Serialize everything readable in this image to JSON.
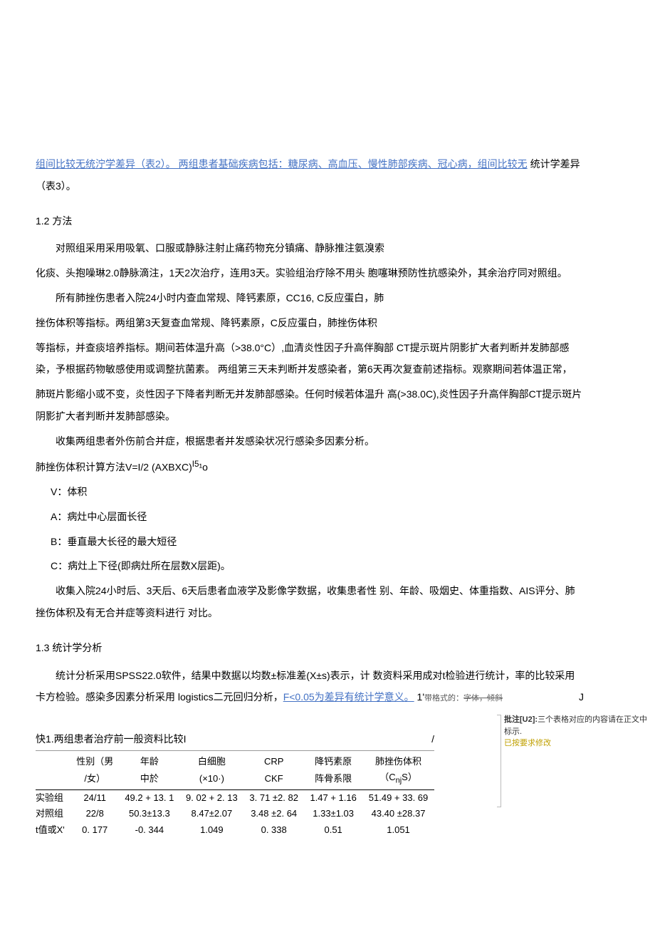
{
  "intro": {
    "link_prefix": "组间比较无统泞学差异（表2）。 两组患者基础疾病包括：糖尿病、高血压、慢性肺部疾病、冠心病，组间比较无",
    "link_suffix": " 统计学差异（表3）。"
  },
  "section_1_2": "1.2   方法",
  "p1": "对照组采用采用吸氧、口服或静脉注射止痛药物充分镇痛、静脉推注氨溴索",
  "p2": "化痰、头抱噪琳2.0静脉滴注，1天2次治疗，连用3天。实验组治疗除不用头   胞噻琳预防性抗感染外，其余治疗同对照组。",
  "p3": "所有肺挫伤患者入院24小时内查血常规、降钙素原，CC16, C反应蛋白，肺",
  "p4": "挫伤体积等指标。两组第3天复查血常规、降钙素原，C反应蛋白，肺挫伤体积",
  "p5": "等指标，并查痰培养指标。期间若体温升高（>38.0°C）,血清炎性因子升高伴胸部 CT提示斑片阴影扩大者判断并发肺部感染，予根据药物敏感使用或调整抗菌素。 两组第三天未判断并发感染者，第6天再次复查前述指标。观察期间若体温正常，",
  "p6": "肺斑片影缩小或不变，炎性因子下降者判断无并发肺部感染。任何时候若体温升   高(>38.0C),炎性因子升高伴胸部CT提示斑片阴影扩大者判断并发肺部感染。",
  "p7": "收集两组患者外伤前合并症，根据患者并发感染状况行感染多因素分析。",
  "p8_prefix": "肺挫伤体积计算方法V=I/2 (AXBXC)",
  "p8_sup": "I5",
  "p8_suffix": "¹o",
  "p9": "V：体积",
  "p10": "A：病灶中心层面长径",
  "p11": "B：垂直最大长径的最大短径",
  "p12": "C：病灶上下径(即病灶所在层数X层距)。",
  "p13": "收集入院24小时后、3天后、6天后患者血液学及影像学数据，收集患者性     别、年龄、吸烟史、体重指数、AIS评分、肺挫伤体积及有无合并症等资料进行 对比。",
  "section_1_3": "1.3    统计学分析",
  "p14_a": "统计分析采用SPSS22.0软件，结果中数据以均数±标准差(X±s)表示，计 数资料采用成对t检验进行统计，率的比较采用卡方检验。感染多因素分析采用 ",
  "p14_b": "logistics二元回归分析",
  "p14_c": "，",
  "p14_link": "F<0.05为差异有统计学意义。",
  "p14_d": " 1'",
  "format_note": "带格式的：",
  "format_detail": "字体，倾斜",
  "j_mark": "J",
  "table1": {
    "title": "快1.两组患者治疗前一般资料比较I",
    "slash": "/",
    "headers": {
      "h1a": "性别（男",
      "h1b": "/女）",
      "h2a": "年龄",
      "h2b": "中於",
      "h3a": "白细胞",
      "h3b": "(×10·)",
      "h4a": "CRP",
      "h4b": "CKF",
      "h5a": "降钙素原",
      "h5b": "阵骨系限",
      "h6a": "肺挫伤体积",
      "h6b": "（C",
      "h6c": "nj",
      "h6d": "S）"
    },
    "rows": [
      {
        "label": "实验组",
        "c1": "24/11",
        "c2": "49.2 + 13. 1",
        "c3": "9. 02 + 2. 13",
        "c4": "3. 71 ±2. 82",
        "c5": "1.47 + 1.16",
        "c6": "51.49 + 33. 69"
      },
      {
        "label": "对照组",
        "c1": "22/8",
        "c2": "50.3±13.3",
        "c3": "8.47±2.07",
        "c4": "3.48 ±2. 64",
        "c5": "1.33±1.03",
        "c6": "43.40 ±28.37"
      },
      {
        "label": "t值或X'",
        "c1": "0. 177",
        "c2": "-0. 344",
        "c3": "1.049",
        "c4": "0. 338",
        "c5": "0.51",
        "c6": "1.051"
      }
    ]
  },
  "comment": {
    "label": "批注[U2]:",
    "text": "三个表格对应的内容请在正文中标示.",
    "response": "已按要求修改"
  }
}
